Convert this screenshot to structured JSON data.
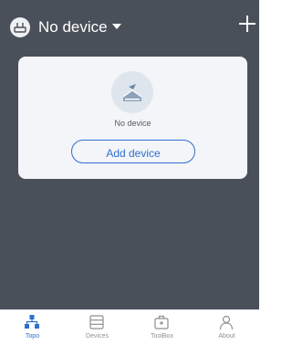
{
  "header": {
    "title": "No device",
    "icons": {
      "device": "router-icon",
      "dropdown": "caret-down-icon",
      "add": "plus-icon"
    }
  },
  "card": {
    "message": "No device",
    "button_label": "Add device",
    "icon": "router-placeholder-icon"
  },
  "tabs": [
    {
      "label": "Topo",
      "icon": "topology-icon",
      "active": true
    },
    {
      "label": "Devices",
      "icon": "devices-icon",
      "active": false
    },
    {
      "label": "ToolBox",
      "icon": "toolbox-icon",
      "active": false
    },
    {
      "label": "About",
      "icon": "person-icon",
      "active": false
    }
  ],
  "colors": {
    "background": "#4a505a",
    "accent": "#2f6fcf",
    "card": "#f3f5f8"
  }
}
